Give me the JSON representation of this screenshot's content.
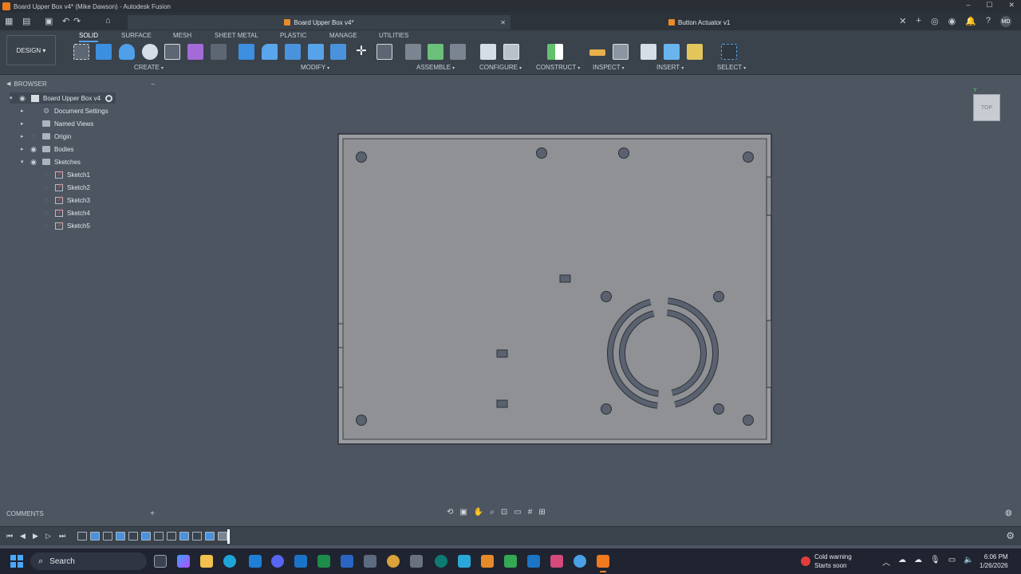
{
  "window": {
    "title": "Board Upper Box v4* (Mike Dawson) - Autodesk Fusion",
    "controls": [
      "–",
      "☐",
      "✕"
    ]
  },
  "tabs": [
    {
      "label": "Board Upper Box v4*",
      "active": true
    },
    {
      "label": "Button Actuator v1",
      "active": false
    }
  ],
  "user_initials": "MD",
  "toolbar": {
    "workspace": "DESIGN",
    "workspace_tabs": [
      "SOLID",
      "SURFACE",
      "MESH",
      "SHEET METAL",
      "PLASTIC",
      "MANAGE",
      "UTILITIES"
    ],
    "active_tab": "SOLID",
    "groups": [
      "CREATE",
      "MODIFY",
      "ASSEMBLE",
      "CONFIGURE",
      "CONSTRUCT",
      "INSPECT",
      "INSERT",
      "SELECT"
    ]
  },
  "browser": {
    "header": "BROWSER",
    "root": "Board Upper Box v4",
    "items": [
      {
        "label": "Document Settings",
        "icon": "gear-icon"
      },
      {
        "label": "Named Views",
        "icon": "folder-icon"
      },
      {
        "label": "Origin",
        "icon": "folder-icon"
      },
      {
        "label": "Bodies",
        "icon": "folder-icon"
      },
      {
        "label": "Sketches",
        "icon": "folder-icon"
      }
    ],
    "sketches": [
      "Sketch1",
      "Sketch2",
      "Sketch3",
      "Sketch4",
      "Sketch5"
    ]
  },
  "viewcube": {
    "label": "TOP"
  },
  "comments": {
    "label": "COMMENTS"
  },
  "taskbar": {
    "search_placeholder": "Search",
    "weather_title": "Cold warning",
    "weather_sub": "Starts soon",
    "time": "6:06 PM",
    "date": "1/26/2026"
  },
  "colors": {
    "canvas_bg": "#4d5561",
    "plate_face": "#8c8e91",
    "plate_edge": "#2e3238",
    "hole_fill": "#5a6270",
    "accent": "#f07a1e"
  }
}
